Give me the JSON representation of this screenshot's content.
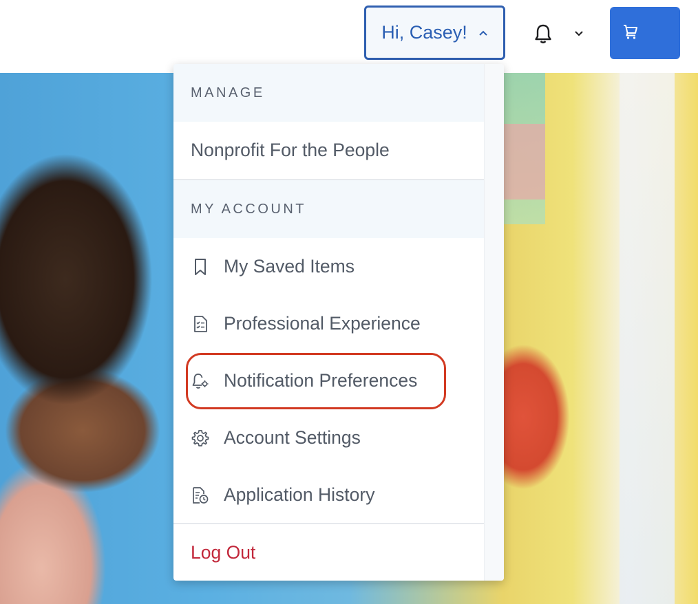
{
  "header": {
    "greeting": "Hi, Casey!",
    "greeting_caret_icon": "chevron-up-icon",
    "notifications_icon": "bell-icon",
    "notifications_caret_icon": "chevron-down-icon",
    "cart_icon": "cart-icon",
    "accent_color": "#2f6fda"
  },
  "menu": {
    "manage_heading": "MANAGE",
    "manage_items": [
      {
        "label": "Nonprofit For the People"
      }
    ],
    "account_heading": "MY ACCOUNT",
    "account_items": [
      {
        "label": "My Saved Items",
        "icon": "bookmark-icon"
      },
      {
        "label": "Professional Experience",
        "icon": "checklist-icon"
      },
      {
        "label": "Notification Preferences",
        "icon": "bell-settings-icon",
        "highlighted": true
      },
      {
        "label": "Account Settings",
        "icon": "gear-icon"
      },
      {
        "label": "Application History",
        "icon": "document-clock-icon"
      }
    ],
    "logout_label": "Log Out",
    "highlight_color": "#d23a22",
    "logout_color": "#c2283b"
  }
}
